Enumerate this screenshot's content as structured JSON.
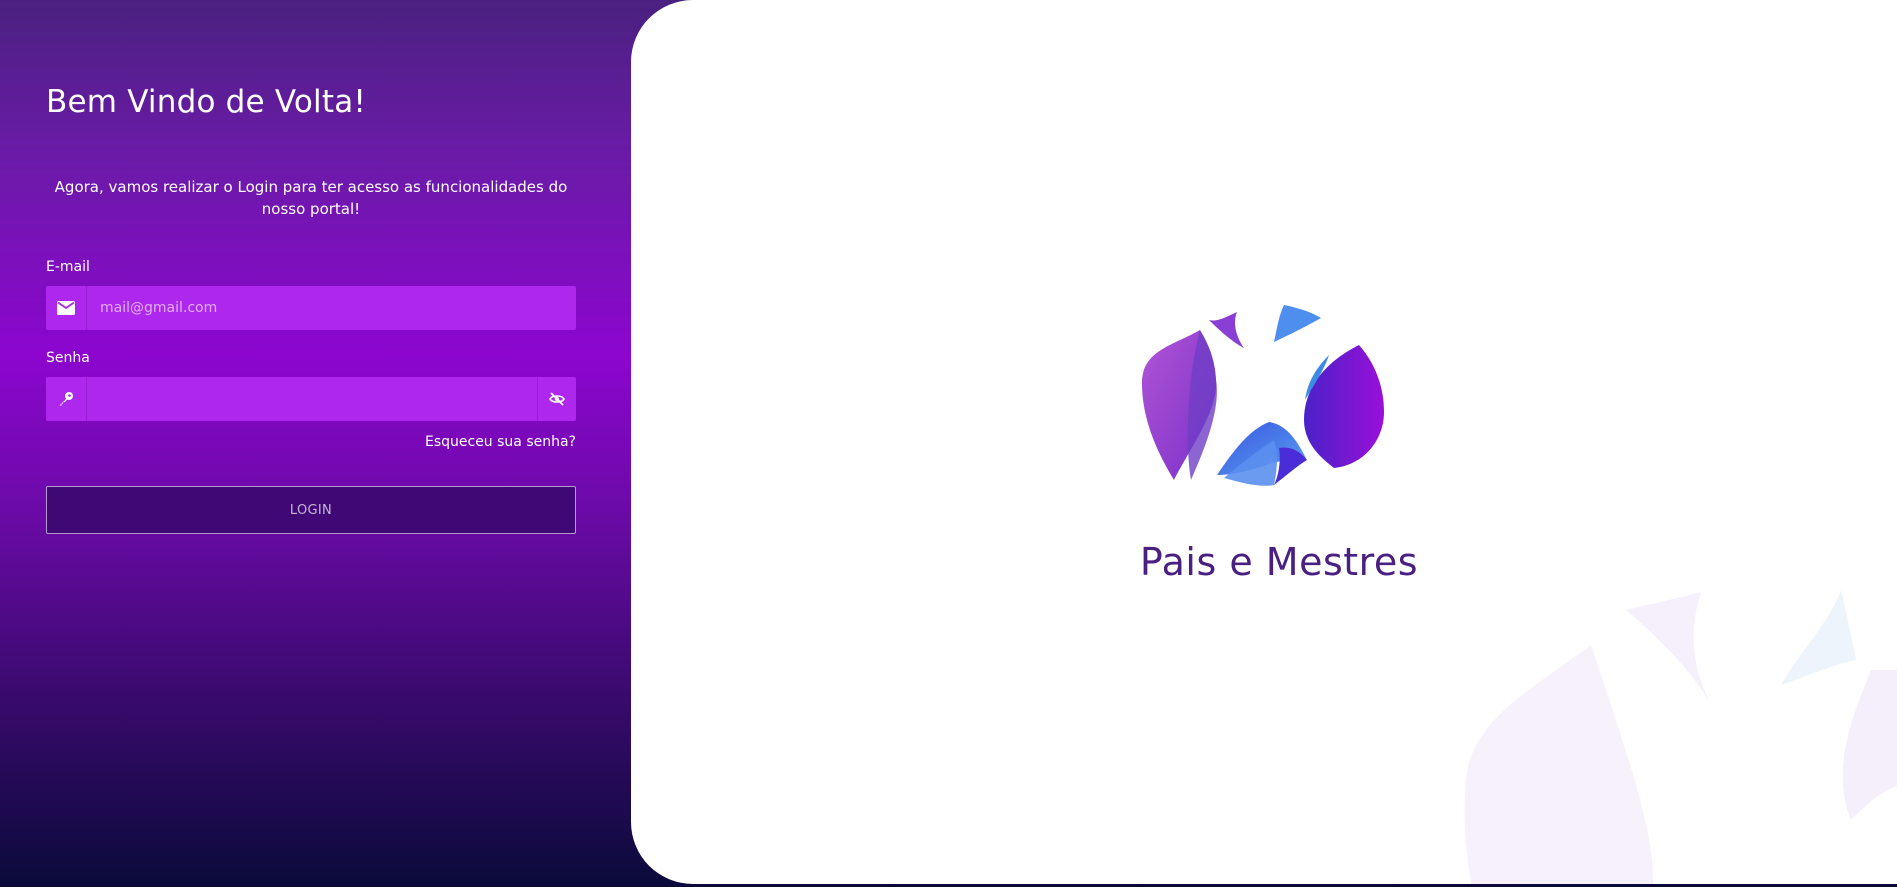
{
  "login": {
    "title": "Bem Vindo de Volta!",
    "subtitle": "Agora, vamos realizar o Login para ter acesso as funcionalidades do nosso portal!",
    "email": {
      "label": "E-mail",
      "placeholder": "mail@gmail.com",
      "value": "",
      "icon": "envelope-icon"
    },
    "password": {
      "label": "Senha",
      "placeholder": "",
      "value": "",
      "icon": "key-icon",
      "toggle_icon": "eye-off-icon"
    },
    "forgot_label": "Esqueceu sua senha?",
    "login_label": "LOGIN"
  },
  "brand": {
    "name": "Pais e Mestres"
  },
  "colors": {
    "input_bg": "#ad27ec",
    "button_bg": "#3f0874",
    "brand_text": "#4a1f82",
    "logo_purple": "#7a16d9",
    "logo_blue": "#4a8ff0"
  }
}
